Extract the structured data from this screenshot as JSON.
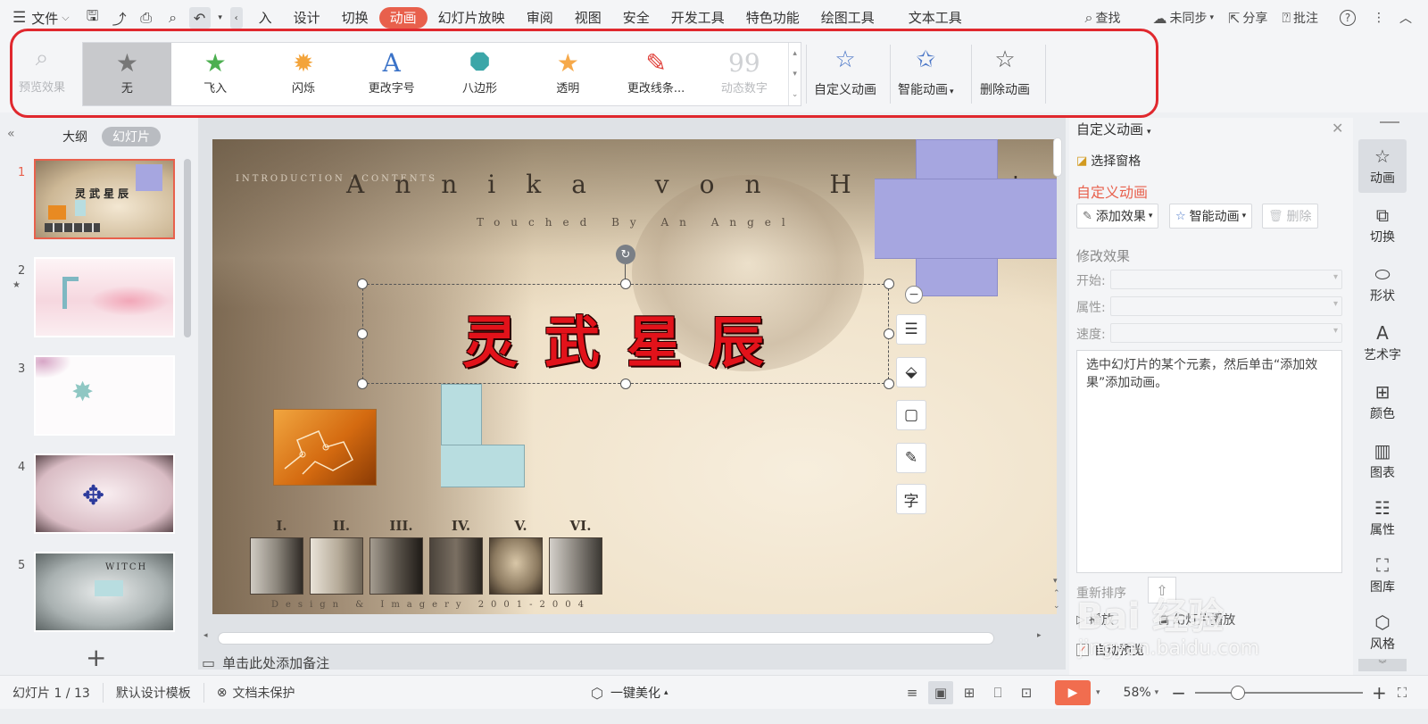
{
  "menubar": {
    "file": "文件",
    "tabs": [
      "入",
      "设计",
      "切换",
      "动画",
      "幻灯片放映",
      "审阅",
      "视图",
      "安全",
      "开发工具",
      "特色功能",
      "绘图工具",
      "文本工具"
    ],
    "active_tab": "动画",
    "search": "查找",
    "sync": "未同步",
    "share": "分享",
    "review": "批注"
  },
  "ribbon": {
    "preview": "预览效果",
    "gallery": [
      {
        "label": "无",
        "icon": "star-gray-icon",
        "selected": true,
        "disabled": false
      },
      {
        "label": "飞入",
        "icon": "fly-in-icon",
        "selected": false,
        "disabled": false
      },
      {
        "label": "闪烁",
        "icon": "flash-icon",
        "selected": false,
        "disabled": false
      },
      {
        "label": "更改字号",
        "icon": "change-font-size-icon",
        "selected": false,
        "disabled": false
      },
      {
        "label": "八边形",
        "icon": "octagon-icon",
        "selected": false,
        "disabled": false
      },
      {
        "label": "透明",
        "icon": "transparent-star-icon",
        "selected": false,
        "disabled": false
      },
      {
        "label": "更改线条...",
        "icon": "change-line-icon",
        "selected": false,
        "disabled": false
      },
      {
        "label": "动态数字",
        "icon": "dynamic-number-icon",
        "selected": false,
        "disabled": true
      }
    ],
    "custom_animation": "自定义动画",
    "smart_animation": "智能动画",
    "delete_animation": "删除动画"
  },
  "left_panel": {
    "tab_outline": "大纲",
    "tab_slides": "幻灯片",
    "slides": [
      {
        "num": "1",
        "active": true
      },
      {
        "num": "2",
        "active": false,
        "has_animation": true
      },
      {
        "num": "3",
        "active": false
      },
      {
        "num": "4",
        "active": false
      },
      {
        "num": "5",
        "active": false
      }
    ]
  },
  "slide": {
    "name": "Annika von Holdt",
    "subtitle": "Touched By An Angel",
    "intro": "INTRODUCTION · CONTENTS",
    "title": "灵武星辰",
    "numerals": [
      "I.",
      "II.",
      "III.",
      "IV.",
      "V.",
      "VI."
    ],
    "footer": "Design & Imagery 2001-2004"
  },
  "notes_placeholder": "单击此处添加备注",
  "right_panel": {
    "title": "自定义动画",
    "select_pane": "选择窗格",
    "section": "自定义动画",
    "add_effect": "添加效果",
    "smart_animation": "智能动画",
    "delete": "删除",
    "modify_effect": "修改效果",
    "start_label": "开始:",
    "property_label": "属性:",
    "speed_label": "速度:",
    "hint": "选中幻灯片的某个元素，然后单击“添加效果”添加动画。",
    "reorder": "重新排序",
    "play": "播放",
    "slideshow_play": "幻灯片播放",
    "auto_preview": "自动预览",
    "auto_preview_checked": true
  },
  "sidebar": {
    "items": [
      {
        "label": "动画",
        "icon": "animation-star-icon",
        "active": true
      },
      {
        "label": "切换",
        "icon": "transition-icon",
        "active": false
      },
      {
        "label": "形状",
        "icon": "shapes-icon",
        "active": false
      },
      {
        "label": "艺术字",
        "icon": "wordart-icon",
        "active": false
      },
      {
        "label": "颜色",
        "icon": "color-grid-icon",
        "active": false
      },
      {
        "label": "图表",
        "icon": "chart-icon",
        "active": false
      },
      {
        "label": "属性",
        "icon": "properties-icon",
        "active": false
      },
      {
        "label": "图库",
        "icon": "gallery-icon",
        "active": false
      },
      {
        "label": "风格",
        "icon": "style-icon",
        "active": false
      }
    ]
  },
  "statusbar": {
    "slide_counter": "幻灯片 1 / 13",
    "template": "默认设计模板",
    "protection": "文档未保护",
    "beautify": "一键美化",
    "zoom": "58%",
    "zoom_fraction": 0.58
  },
  "watermark": {
    "brand": "Bai 经验",
    "url": "jingyan.baidu.com"
  }
}
